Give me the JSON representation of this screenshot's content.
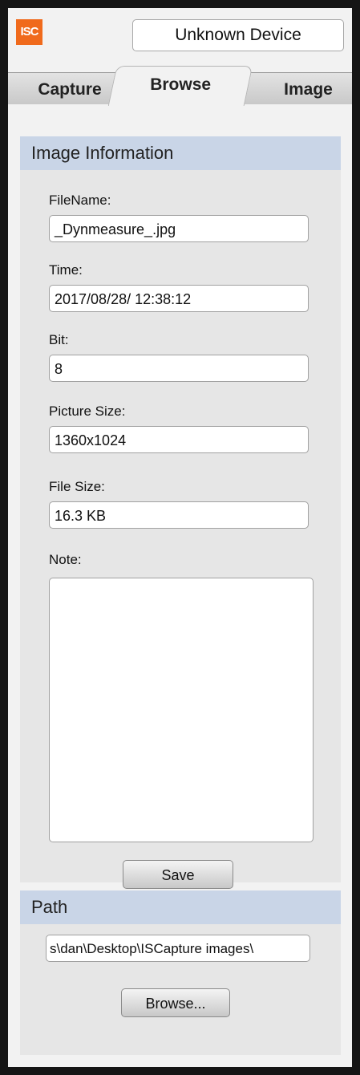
{
  "header": {
    "logo_text": "ISC",
    "device_name": "Unknown Device"
  },
  "tabs": [
    {
      "label": "Capture",
      "active": false
    },
    {
      "label": "Browse",
      "active": true
    },
    {
      "label": "Image",
      "active": false
    }
  ],
  "image_info": {
    "title": "Image Information",
    "filename_label": "FileName:",
    "filename_value": "_Dynmeasure_.jpg",
    "time_label": "Time:",
    "time_value": "2017/08/28/ 12:38:12",
    "bit_label": "Bit:",
    "bit_value": "8",
    "picture_size_label": "Picture Size:",
    "picture_size_value": "1360x1024",
    "file_size_label": "File Size:",
    "file_size_value": "16.3 KB",
    "note_label": "Note:",
    "note_value": "",
    "save_label": "Save"
  },
  "path": {
    "title": "Path",
    "value": "s\\dan\\Desktop\\ISCapture images\\",
    "browse_label": "Browse..."
  },
  "colors": {
    "logo": "#f06a1c",
    "section_header": "#c9d5e7",
    "panel": "#f2f2f2",
    "frame": "#151515"
  }
}
